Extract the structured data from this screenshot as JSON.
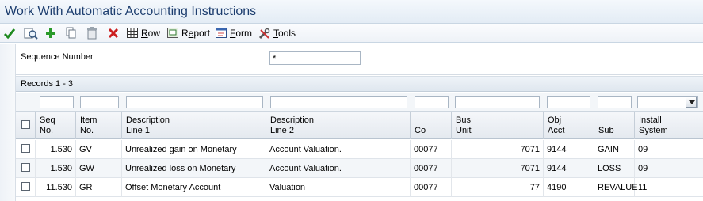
{
  "window": {
    "title": "Work With Automatic Accounting Instructions"
  },
  "toolbar": {
    "row_label": "Row",
    "report_label": "Report",
    "form_label": "Form",
    "tools_label": "Tools",
    "row_key": "R",
    "report_key": "e",
    "form_key": "F",
    "tools_key": "T",
    "colors": {
      "ok": "#1f8a1f",
      "add": "#2a9a2a",
      "delete": "#cc1f1f"
    }
  },
  "query": {
    "sequence_label": "Sequence Number",
    "sequence_value": "*"
  },
  "grid": {
    "records_label": "Records 1 - 3",
    "columns": [
      {
        "line1": "Seq",
        "line2": "No."
      },
      {
        "line1": "Item",
        "line2": "No."
      },
      {
        "line1": "Description",
        "line2": "Line 1"
      },
      {
        "line1": "Description",
        "line2": "Line 2"
      },
      {
        "line1": "",
        "line2": "Co"
      },
      {
        "line1": "Bus",
        "line2": "Unit"
      },
      {
        "line1": "Obj",
        "line2": "Acct"
      },
      {
        "line1": "",
        "line2": "Sub"
      },
      {
        "line1": "Install",
        "line2": "System"
      }
    ],
    "rows": [
      {
        "seq": "1.530",
        "item": "GV",
        "desc1": "Unrealized gain on Monetary",
        "desc2": "Account Valuation.",
        "co": "00077",
        "bu": "7071",
        "obj": "9144",
        "sub": "GAIN",
        "sys": "09"
      },
      {
        "seq": "1.530",
        "item": "GW",
        "desc1": "Unrealized loss on Monetary",
        "desc2": "Account Valuation.",
        "co": "00077",
        "bu": "7071",
        "obj": "9144",
        "sub": "LOSS",
        "sys": "09"
      },
      {
        "seq": "11.530",
        "item": "GR",
        "desc1": "Offset Monetary Account",
        "desc2": "Valuation",
        "co": "00077",
        "bu": "77",
        "obj": "4190",
        "sub": "REVALUE",
        "sys": "11"
      }
    ]
  }
}
